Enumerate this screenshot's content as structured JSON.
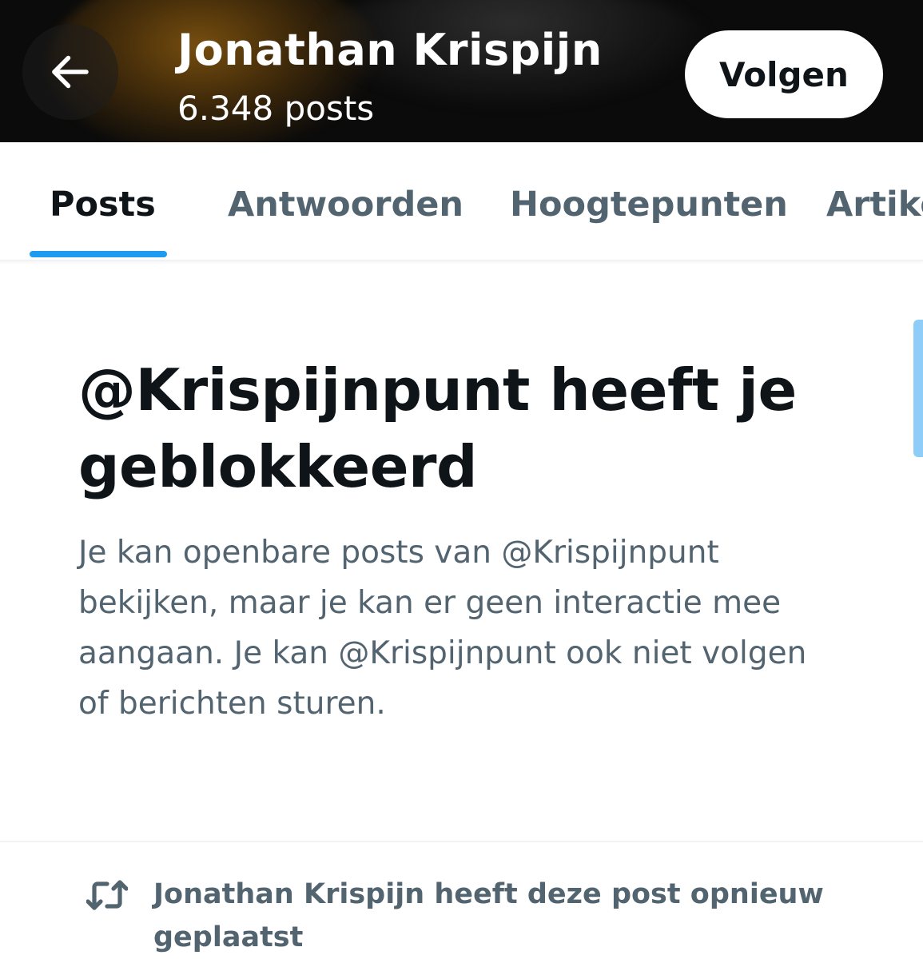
{
  "header": {
    "title": "Jonathan Krispijn",
    "subtitle": "6.348 posts",
    "follow_label": "Volgen",
    "back_icon": "arrow-left-icon"
  },
  "tabs": [
    {
      "label": "Posts",
      "active": true
    },
    {
      "label": "Antwoorden",
      "active": false
    },
    {
      "label": "Hoogtepunten",
      "active": false
    },
    {
      "label": "Artikelen",
      "active": false
    }
  ],
  "blocked": {
    "heading": "@Krispijnpunt heeft je geblokkeerd",
    "body": "Je kan openbare posts van @Krispijnpunt bekijken, maar je kan er geen interactie mee aangaan. Je kan @Krispijnpunt ook niet volgen of berichten sturen."
  },
  "repost": {
    "icon": "repost-icon",
    "text": "Jonathan Krispijn heeft deze post opnieuw geplaatst"
  },
  "colors": {
    "accent": "#1d9bf0",
    "text_primary": "#0f1419",
    "text_secondary": "#536471",
    "header_bg": "#0b0b0b"
  }
}
